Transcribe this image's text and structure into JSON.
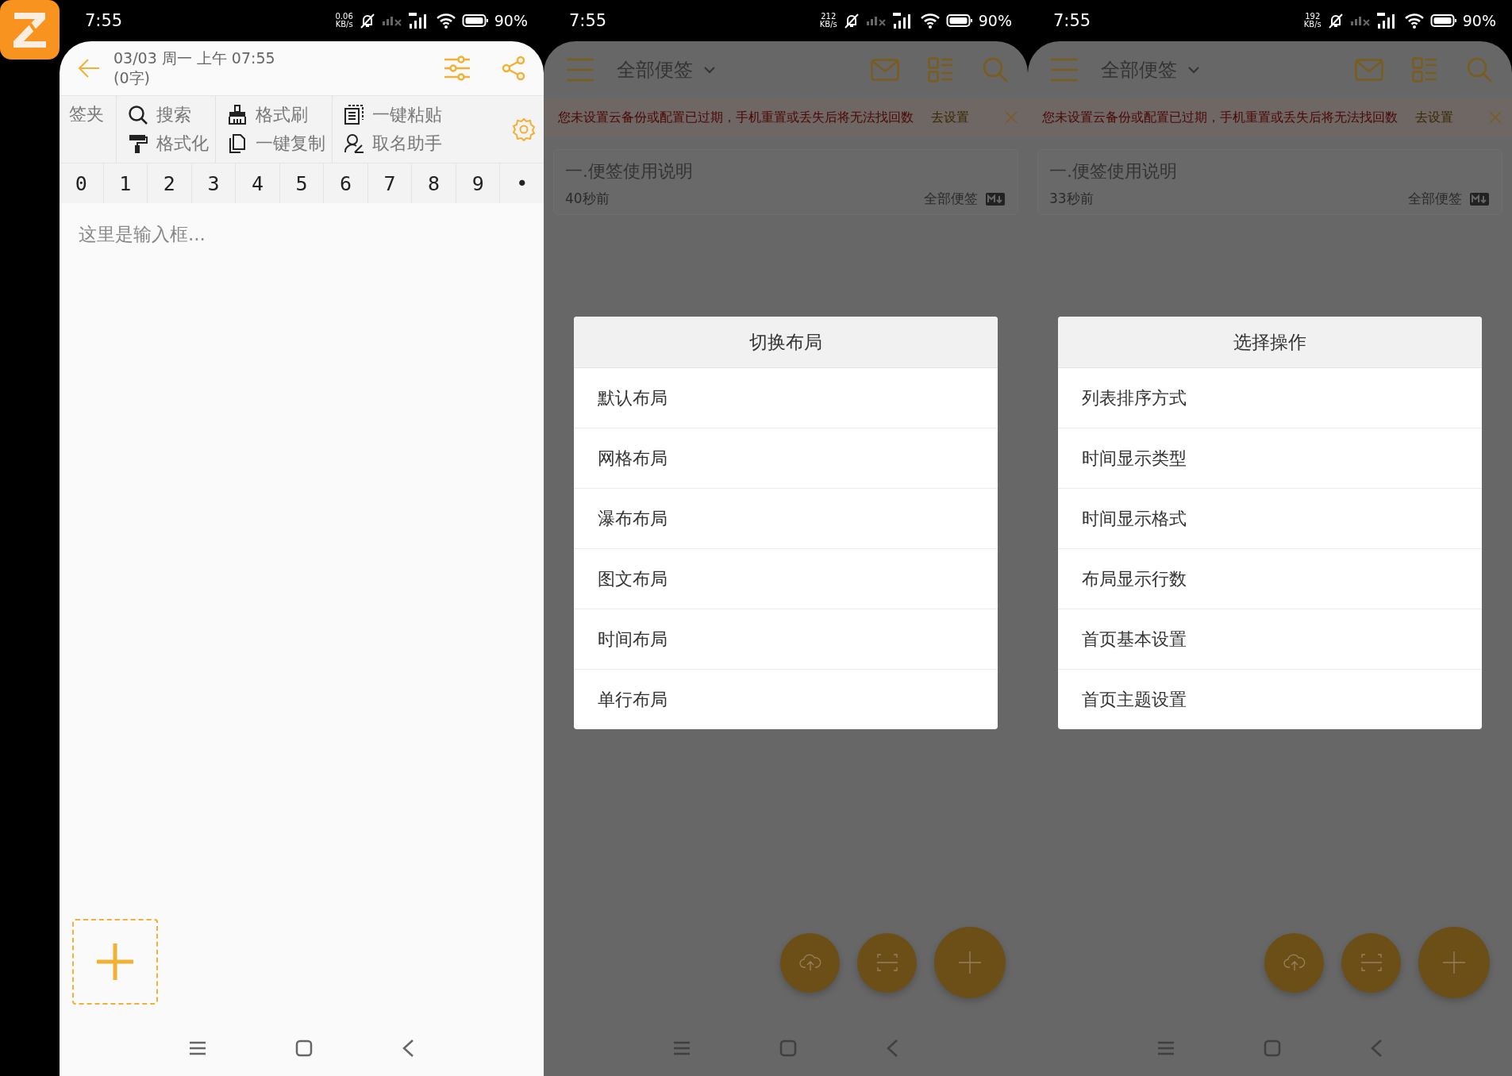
{
  "editor": {
    "status_bar": {
      "time": "7:55",
      "speed": "0.06",
      "speed_unit": "KB/s",
      "battery": "90%"
    },
    "header": {
      "date": "03/03 周一 上午 07:55",
      "count": "(0字)"
    },
    "toolbar": {
      "label": "签夹",
      "tools": [
        {
          "label": "搜索"
        },
        {
          "label": "格式化"
        },
        {
          "label": "格式刷"
        },
        {
          "label": "一键复制"
        },
        {
          "label": "一键粘贴"
        },
        {
          "label": "取名助手"
        }
      ]
    },
    "digits": [
      "0",
      "1",
      "2",
      "3",
      "4",
      "5",
      "6",
      "7",
      "8",
      "9",
      "•"
    ],
    "input": {
      "placeholder": "这里是输入框..."
    }
  },
  "lists": [
    {
      "status_bar": {
        "time": "7:55",
        "speed": "212",
        "speed_unit": "KB/s",
        "battery": "90%"
      },
      "title": "全部便签",
      "banner": {
        "text": "您未设置云备份或配置已过期，手机重置或丢失后将无法找回数",
        "action": "去设置"
      },
      "note": {
        "title": "一.便签使用说明",
        "time": "40秒前",
        "folder": "全部便签"
      },
      "dialog": {
        "title": "切换布局",
        "options": [
          "默认布局",
          "网格布局",
          "瀑布布局",
          "图文布局",
          "时间布局",
          "单行布局"
        ]
      }
    },
    {
      "status_bar": {
        "time": "7:55",
        "speed": "192",
        "speed_unit": "KB/s",
        "battery": "90%"
      },
      "title": "全部便签",
      "banner": {
        "text": "您未设置云备份或配置已过期，手机重置或丢失后将无法找回数",
        "action": "去设置"
      },
      "note": {
        "title": "一.便签使用说明",
        "time": "33秒前",
        "folder": "全部便签"
      },
      "dialog": {
        "title": "选择操作",
        "options": [
          "列表排序方式",
          "时间显示类型",
          "时间显示格式",
          "布局显示行数",
          "首页基本设置",
          "首页主题设置"
        ]
      }
    }
  ]
}
